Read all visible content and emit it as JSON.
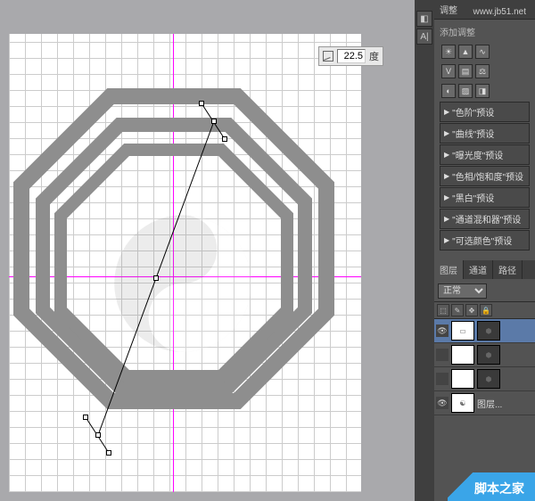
{
  "options_bar": {
    "angle_value": "22.5",
    "angle_unit": "度"
  },
  "adjustments_panel": {
    "tab_label": "调整",
    "add_label": "添加调整",
    "presets": [
      "\"色阶\"预设",
      "\"曲线\"预设",
      "\"曝光度\"预设",
      "\"色相/饱和度\"预设",
      "\"黑白\"预设",
      "\"通道混和器\"预设",
      "\"可选颜色\"预设"
    ]
  },
  "layers_panel": {
    "tabs": [
      "图层",
      "通道",
      "路径"
    ],
    "blend_mode": "正常",
    "bottom_label": "图层..."
  },
  "watermark": {
    "text": "脚本之家",
    "url": "www.jb51.net"
  }
}
